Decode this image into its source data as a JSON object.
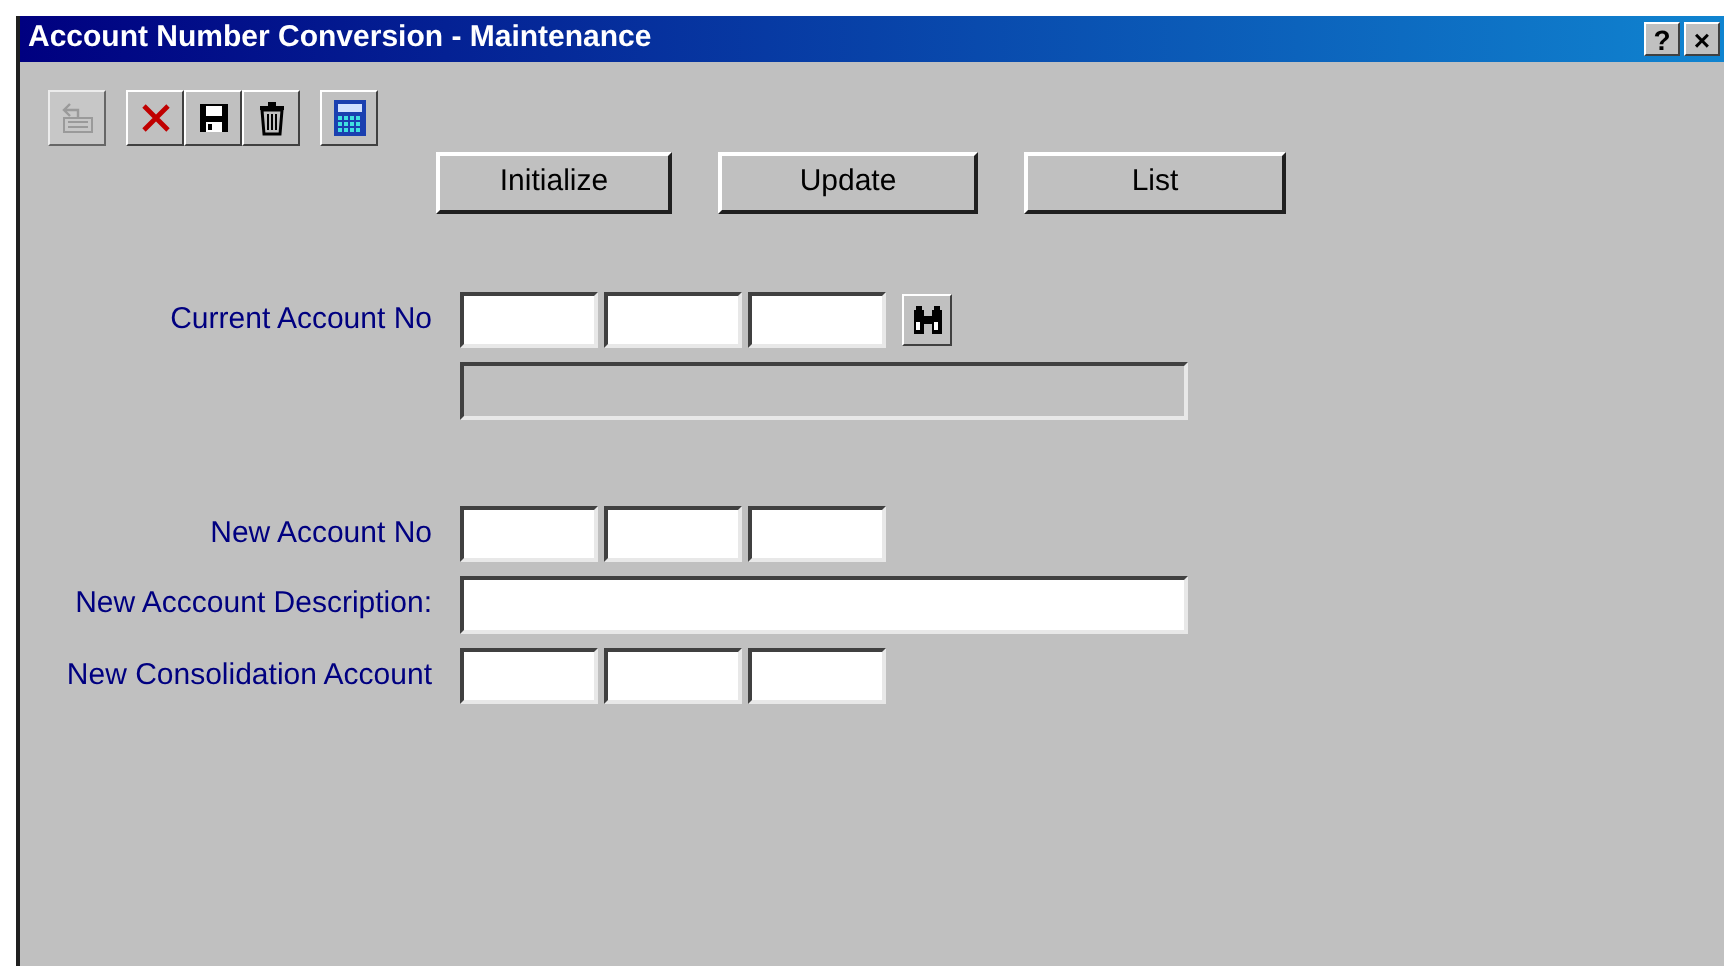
{
  "window": {
    "title": "Account Number Conversion - Maintenance",
    "title_buttons": [
      "?",
      "×"
    ]
  },
  "toolbar": [
    [
      {
        "kind": "keyboard",
        "disabled": true
      }
    ],
    [
      {
        "kind": "delete",
        "disabled": false
      },
      {
        "kind": "save",
        "disabled": false
      },
      {
        "kind": "trash",
        "disabled": false
      }
    ],
    [
      {
        "kind": "calculator",
        "disabled": false
      }
    ]
  ],
  "actions": [
    "Initialize",
    "Update",
    "List"
  ],
  "current_account": {
    "label": "Current Account No",
    "description_disabled": true
  },
  "new_fields": [
    {
      "kind": "segmented",
      "label": "New Account No"
    },
    {
      "kind": "text",
      "label": "New Acccount Description:"
    },
    {
      "kind": "segmented",
      "label": "New Consolidation Account"
    }
  ]
}
